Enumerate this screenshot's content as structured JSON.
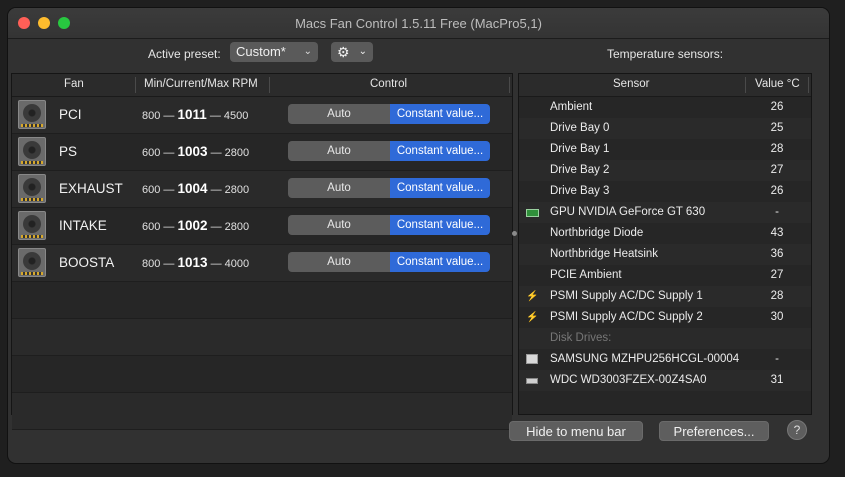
{
  "window": {
    "title": "Macs Fan Control 1.5.11 Free (MacPro5,1)"
  },
  "preset": {
    "label": "Active preset:",
    "value": "Custom*"
  },
  "temp_label": "Temperature sensors:",
  "fan_table": {
    "headers": {
      "fan": "Fan",
      "rpm": "Min/Current/Max RPM",
      "control": "Control"
    },
    "fans": [
      {
        "name": "PCI",
        "min": "800",
        "current": "1011",
        "max": "4500",
        "auto": "Auto",
        "constant": "Constant value..."
      },
      {
        "name": "PS",
        "min": "600",
        "current": "1003",
        "max": "2800",
        "auto": "Auto",
        "constant": "Constant value..."
      },
      {
        "name": "EXHAUST",
        "min": "600",
        "current": "1004",
        "max": "2800",
        "auto": "Auto",
        "constant": "Constant value..."
      },
      {
        "name": "INTAKE",
        "min": "600",
        "current": "1002",
        "max": "2800",
        "auto": "Auto",
        "constant": "Constant value..."
      },
      {
        "name": "BOOSTA",
        "min": "800",
        "current": "1013",
        "max": "4000",
        "auto": "Auto",
        "constant": "Constant value..."
      }
    ]
  },
  "sensor_table": {
    "headers": {
      "sensor": "Sensor",
      "value": "Value °C"
    },
    "rows": [
      {
        "name": "Ambient",
        "value": "26",
        "icon": ""
      },
      {
        "name": "Drive Bay 0",
        "value": "25",
        "icon": ""
      },
      {
        "name": "Drive Bay 1",
        "value": "28",
        "icon": ""
      },
      {
        "name": "Drive Bay 2",
        "value": "27",
        "icon": ""
      },
      {
        "name": "Drive Bay 3",
        "value": "26",
        "icon": ""
      },
      {
        "name": "GPU NVIDIA GeForce GT  630",
        "value": "-",
        "icon": "gpu-icon"
      },
      {
        "name": "Northbridge Diode",
        "value": "43",
        "icon": ""
      },
      {
        "name": "Northbridge Heatsink",
        "value": "36",
        "icon": ""
      },
      {
        "name": "PCIE Ambient",
        "value": "27",
        "icon": ""
      },
      {
        "name": "PSMI Supply AC/DC Supply 1",
        "value": "28",
        "icon": "bolt-icon"
      },
      {
        "name": "PSMI Supply AC/DC Supply 2",
        "value": "30",
        "icon": "bolt-icon"
      },
      {
        "name": "Disk Drives:",
        "value": "",
        "icon": "",
        "section": true
      },
      {
        "name": "SAMSUNG MZHPU256HCGL-00004",
        "value": "-",
        "icon": "ssd-icon"
      },
      {
        "name": "WDC WD3003FZEX-00Z4SA0",
        "value": "31",
        "icon": "hdd-icon"
      }
    ]
  },
  "buttons": {
    "hide": "Hide to menu bar",
    "prefs": "Preferences...",
    "help": "?"
  }
}
